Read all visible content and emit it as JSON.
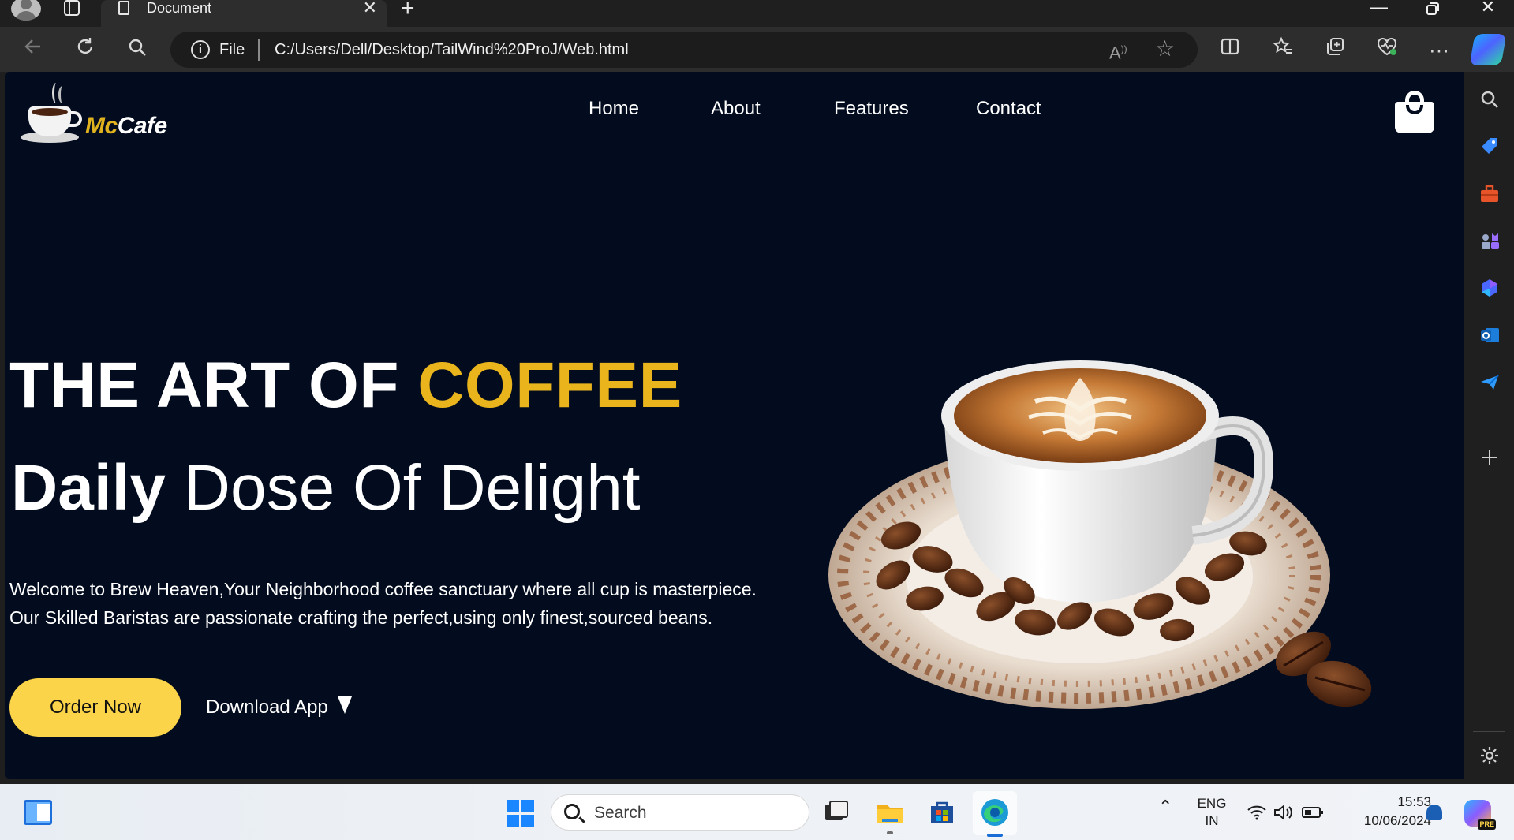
{
  "browser": {
    "tab_title": "Document",
    "address": {
      "scheme_label": "File",
      "url": "C:/Users/Dell/Desktop/TailWind%20ProJ/Web.html"
    }
  },
  "site": {
    "brand": {
      "prefix": "Mc",
      "suffix": "Cafe"
    },
    "nav": [
      {
        "label": "Home"
      },
      {
        "label": "About"
      },
      {
        "label": "Features"
      },
      {
        "label": "Contact"
      }
    ],
    "hero": {
      "headline_main": "THE ART OF ",
      "headline_accent": "COFFEE",
      "subhead_bold": "Daily",
      "subhead_light": " Dose Of Delight",
      "paragraph_line1": "Welcome to Brew Heaven,Your Neighborhood coffee sanctuary where all cup is masterpiece.",
      "paragraph_line2": "Our Skilled Baristas are passionate crafting the perfect,using only finest,sourced beans.",
      "order_button": "Order Now",
      "download_button": "Download App"
    },
    "colors": {
      "background": "#030c1f",
      "accent": "#e9b41c",
      "button": "#fcd449"
    }
  },
  "taskbar": {
    "search_placeholder": "Search",
    "language": "ENG",
    "region": "IN",
    "time": "15:53",
    "date": "10/06/2024",
    "copilot_badge": "PRE"
  },
  "icons": {
    "sidebar": [
      "search-icon",
      "tag-icon",
      "toolbox-icon",
      "chess-icon",
      "copilot-icon",
      "outlook-icon",
      "send-icon",
      "add-icon",
      "settings-icon"
    ],
    "toolbar": [
      "back-icon",
      "refresh-icon",
      "search-icon",
      "read-aloud-icon",
      "favorite-star-icon",
      "split-screen-icon",
      "favorites-icon",
      "collections-icon",
      "health-icon",
      "more-icon"
    ]
  }
}
